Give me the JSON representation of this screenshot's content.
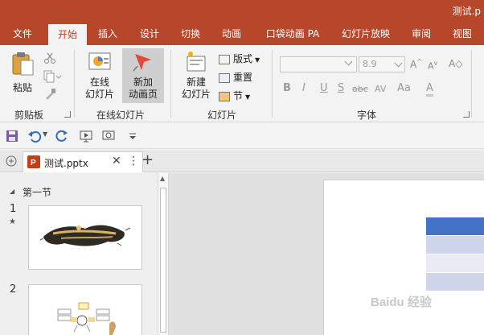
{
  "window": {
    "title": "测试.p"
  },
  "tabs": [
    "文件",
    "开始",
    "插入",
    "设计",
    "切换",
    "动画",
    "口袋动画 PA",
    "幻灯片放映",
    "审阅",
    "视图"
  ],
  "active_tab": "开始",
  "ribbon": {
    "clipboard": {
      "paste_label": "粘贴",
      "group_label": "剪贴板"
    },
    "online_slides": {
      "online_slide_line1": "在线",
      "online_slide_line2": "幻灯片",
      "new_anim_line1": "新加",
      "new_anim_line2": "动画页",
      "group_label": "在线幻灯片"
    },
    "slides": {
      "new_slide_line1": "新建",
      "new_slide_line2": "幻灯片",
      "layout_label": "版式",
      "reset_label": "重置",
      "section_label": "节",
      "group_label": "幻灯片"
    },
    "font": {
      "font_name": "",
      "font_size": "8.9",
      "grow_label": "A",
      "shrink_label": "A",
      "bold": "B",
      "italic": "I",
      "underline": "U",
      "shadow": "S",
      "strike": "abc",
      "spacing": "AV",
      "case": "Aa",
      "color": "A",
      "group_label": "字体"
    }
  },
  "document_tab": {
    "name": "测试.pptx"
  },
  "slide_pane": {
    "section_name": "第一节",
    "slides": [
      {
        "number": "1",
        "marker": "★"
      },
      {
        "number": "2",
        "marker": ""
      }
    ]
  },
  "slide_table": {
    "rows": 4
  },
  "colors": {
    "accent": "#b7472a",
    "table_header": "#4472c4",
    "table_row_a": "#cfd5ea",
    "table_row_b": "#e9ebf5"
  },
  "watermark": "Baidu 经验"
}
